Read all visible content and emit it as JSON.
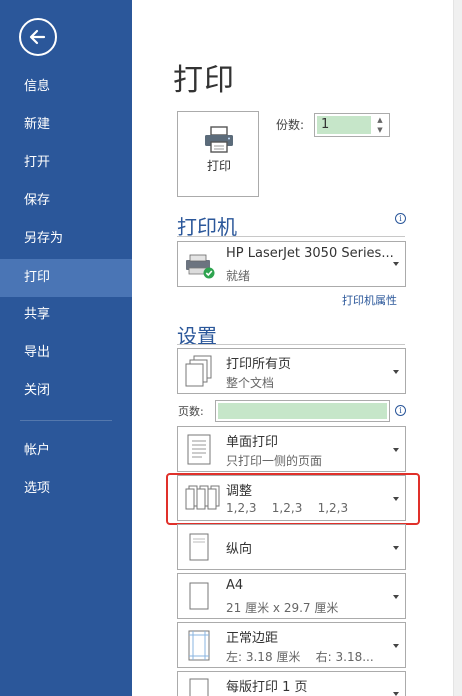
{
  "sidebar": {
    "back_icon": "back-arrow-icon",
    "items": [
      {
        "label": "信息"
      },
      {
        "label": "新建"
      },
      {
        "label": "打开"
      },
      {
        "label": "保存"
      },
      {
        "label": "另存为"
      },
      {
        "label": "打印",
        "active": true
      },
      {
        "label": "共享"
      },
      {
        "label": "导出"
      },
      {
        "label": "关闭"
      },
      {
        "label": "帐户"
      },
      {
        "label": "选项"
      }
    ]
  },
  "main": {
    "title": "打印",
    "print_button_label": "打印",
    "copies_label": "份数:",
    "copies_value": "1",
    "printer_heading": "打印机",
    "printer": {
      "name": "HP LaserJet 3050 Series...",
      "status": "就绪"
    },
    "printer_properties": "打印机属性",
    "settings_heading": "设置",
    "print_range": {
      "line1": "打印所有页",
      "line2": "整个文档"
    },
    "pages_label": "页数:",
    "sides": {
      "line1": "单面打印",
      "line2": "只打印一侧的页面"
    },
    "collate": {
      "line1": "调整",
      "line2": "1,2,3    1,2,3    1,2,3"
    },
    "orientation": {
      "line1": "纵向"
    },
    "paper": {
      "line1": "A4",
      "line2": "21 厘米 x 29.7 厘米"
    },
    "margins": {
      "line1": "正常边距",
      "line2": "左: 3.18 厘米    右: 3.18..."
    },
    "pages_per_sheet": {
      "line1": "每版打印 1 页"
    },
    "info_icon": "i"
  },
  "colors": {
    "sidebar_bg": "#2b579a",
    "sidebar_active": "#4a75b5",
    "accent": "#2b579a",
    "input_fill": "#c6e6c9",
    "highlight": "#e0302a"
  }
}
